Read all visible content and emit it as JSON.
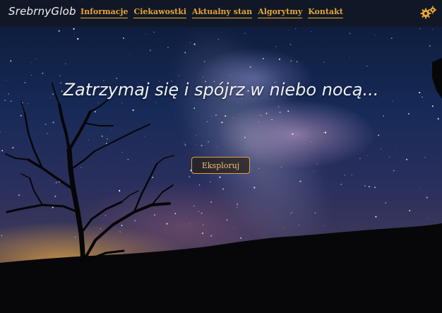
{
  "header": {
    "logo": "SrebrnyGlob",
    "nav": [
      {
        "label": "Informacje"
      },
      {
        "label": "Ciekawostki"
      },
      {
        "label": "Aktualny stan"
      },
      {
        "label": "Algorytmy"
      },
      {
        "label": "Kontakt"
      }
    ],
    "settings_icon": "gears-icon"
  },
  "hero": {
    "headline": "Zatrzymaj się i spójrz w niebo nocą...",
    "cta_label": "Eksploruj"
  },
  "colors": {
    "accent": "#e8a630",
    "headline": "#eef1f8",
    "topbar": "#121620"
  }
}
